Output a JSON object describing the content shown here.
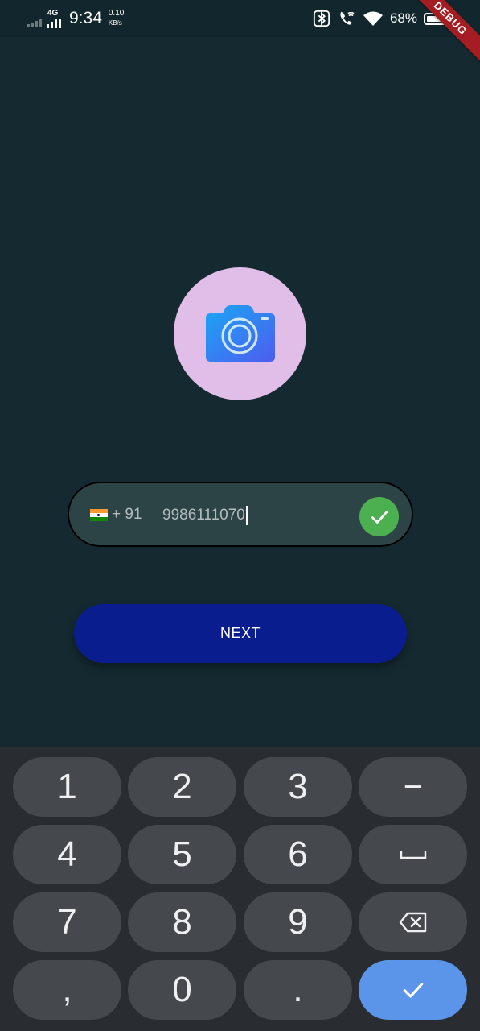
{
  "status_bar": {
    "network_type": "4G",
    "time": "9:34",
    "speed_value": "0.10",
    "speed_unit": "KB/s",
    "battery": "68%",
    "icons": [
      "bluetooth-icon",
      "wifi-calling-icon",
      "wifi-icon",
      "battery-icon"
    ]
  },
  "debug_banner": "DEBUG",
  "avatar": {
    "icon": "camera-icon",
    "bg_color": "#e1bee7"
  },
  "phone_input": {
    "country_flag": "india-flag-icon",
    "country_code": "+ 91",
    "value": "9986111070",
    "valid_icon": "check-icon",
    "valid_color": "#4caf50"
  },
  "next_button": {
    "label": "NEXT",
    "color": "#0a1d8f"
  },
  "keyboard": {
    "keys": [
      "1",
      "2",
      "3",
      "−",
      "4",
      "5",
      "6",
      "␣",
      "7",
      "8",
      "9",
      "⌫",
      ",",
      "0",
      ".",
      "✓"
    ],
    "enter_color": "#5b95e9"
  },
  "colors": {
    "background": "#142a30",
    "field_bg": "#2d4446"
  }
}
